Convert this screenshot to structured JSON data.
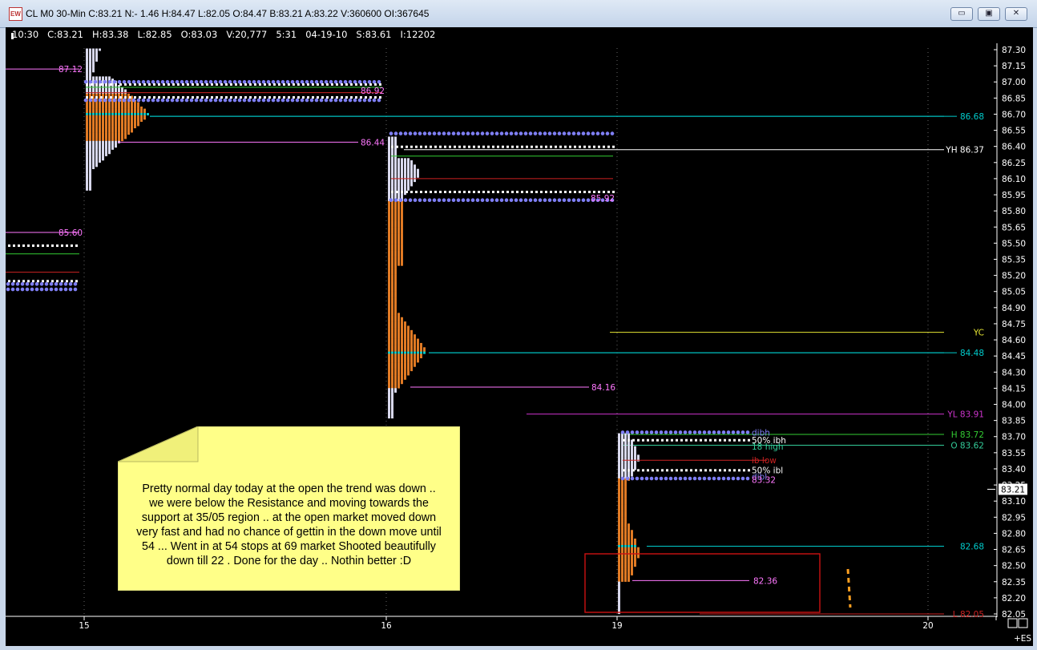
{
  "window": {
    "title": "CL M0 30-Min C:83.21 N:- 1.46 H:84.47 L:82.05 O:84.47 B:83.21 A:83.22 V:360600 OI:367645",
    "app_icon_label": "EW",
    "minimize_symbol": "▭",
    "maximize_symbol": "▣",
    "close_symbol": "✕"
  },
  "status_line": {
    "time": "10:30",
    "close": "C:83.21",
    "high": "H:83.38",
    "low": "L:82.85",
    "open": "O:83.03",
    "volume": "V:20,777",
    "bar": "5:31",
    "date": "04-19-10",
    "s": "S:83.61",
    "i": "I:12202"
  },
  "colors": {
    "background": "#000000",
    "tpo_orange": "#e07a24",
    "tpo_white": "#d8d8ec",
    "ib_dots": "#7f7ff5",
    "poc": "#00cccc",
    "yc": "#e6e633",
    "yh": "#ffffff",
    "yl": "#cc33cc",
    "low_line": "#cc2222",
    "high_line": "#33cc33",
    "open_line": "#33cc99",
    "vpoc": "#ff77ff",
    "note_bg": "#ffff88"
  },
  "chart_data": {
    "type": "market-profile",
    "instrument": "CL M0",
    "timeframe": "30-Min",
    "y_axis": {
      "min": 82.05,
      "max": 87.3,
      "step": 0.15,
      "ticks": [
        "87.30",
        "87.15",
        "87.00",
        "86.85",
        "86.70",
        "86.55",
        "86.40",
        "86.25",
        "86.10",
        "85.95",
        "85.80",
        "85.65",
        "85.50",
        "85.35",
        "85.20",
        "85.05",
        "84.90",
        "84.75",
        "84.60",
        "84.45",
        "84.30",
        "84.15",
        "84.00",
        "83.85",
        "83.70",
        "83.55",
        "83.40",
        "83.25",
        "83.10",
        "82.95",
        "82.80",
        "82.65",
        "82.50",
        "82.35",
        "82.20",
        "82.05"
      ],
      "last_price": "83.21"
    },
    "x_axis": {
      "labels": [
        "15",
        "16",
        "19",
        "20"
      ]
    },
    "sessions": [
      {
        "day": "15",
        "profile_range": [
          86.0,
          87.3
        ],
        "poc": 86.7,
        "value_area": [
          86.45,
          86.9
        ],
        "labels": [
          {
            "text": "87.12",
            "price": 87.12
          },
          {
            "text": "86.92",
            "price": 86.92
          },
          {
            "text": "86.44",
            "price": 86.44
          }
        ]
      },
      {
        "day": "16",
        "profile_range": [
          83.88,
          86.48
        ],
        "poc": 84.48,
        "value_area": [
          84.15,
          85.9
        ],
        "labels": [
          {
            "text": "85.92",
            "price": 85.92
          },
          {
            "text": "84.16",
            "price": 84.16
          },
          {
            "text": "84.48",
            "price": 84.48
          },
          {
            "text": "86.68",
            "price": 86.68
          }
        ]
      },
      {
        "day": "19",
        "profile_range": [
          82.05,
          83.72
        ],
        "poc": 82.68,
        "value_area": [
          82.36,
          83.32
        ],
        "labels": [
          {
            "text": "dibh",
            "price": 83.74
          },
          {
            "text": "50% ibh",
            "price": 83.67
          },
          {
            "text": "18 high",
            "price": 83.61
          },
          {
            "text": "ib low",
            "price": 83.48
          },
          {
            "text": "50% ibl",
            "price": 83.39
          },
          {
            "text": "dibl",
            "price": 83.33
          },
          {
            "text": "83.32",
            "price": 83.3
          },
          {
            "text": "82.36",
            "price": 82.36
          },
          {
            "text": "82.68",
            "price": 82.68
          }
        ]
      }
    ],
    "reference_levels": [
      {
        "label": "86.68",
        "price": 86.68,
        "color": "#00cccc"
      },
      {
        "label": "YH 86.37",
        "price": 86.37,
        "color": "#ffffff"
      },
      {
        "label": "YC",
        "price": 84.67,
        "color": "#e6e633"
      },
      {
        "label": "84.48",
        "price": 84.48,
        "color": "#00cccc"
      },
      {
        "label": "YL 83.91",
        "price": 83.91,
        "color": "#cc33cc"
      },
      {
        "label": "H 83.72",
        "price": 83.72,
        "color": "#33cc33"
      },
      {
        "label": "O 83.62",
        "price": 83.62,
        "color": "#33cc99"
      },
      {
        "label": "82.68",
        "price": 82.68,
        "color": "#00cccc"
      },
      {
        "label": "L 82.05",
        "price": 82.05,
        "color": "#cc2222"
      }
    ],
    "prior_levels": [
      {
        "label": "85.60",
        "price": 85.6
      }
    ]
  },
  "note": {
    "text": "Pretty normal day today at the open the trend was down ..\nwe were below the Resistance and moving towards the\nsupport at 35/05 region .. at the open market moved down\nvery fast and had no chance of gettin in the down move until\n54 ... Went in at 54 stops at 69 market Shooted beautifully\ndown till 22 . Done for the day .. Nothin better :D"
  },
  "corner": {
    "es_label": "+ES"
  }
}
